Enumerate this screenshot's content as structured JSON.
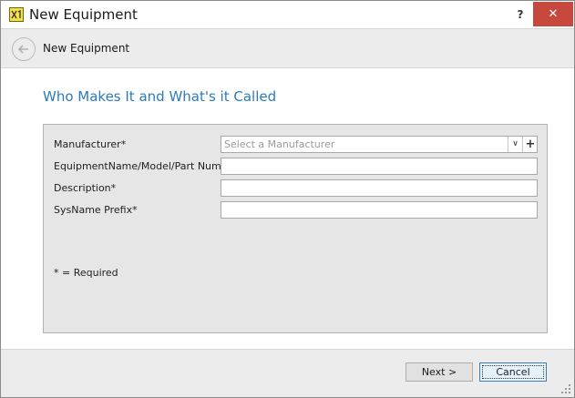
{
  "window": {
    "title": "New Equipment",
    "help_label": "?",
    "close_label": "✕"
  },
  "header": {
    "title": "New Equipment"
  },
  "main": {
    "heading": "Who Makes It and What's it Called"
  },
  "form": {
    "manufacturer_label": "Manufacturer*",
    "manufacturer_placeholder": "Select a Manufacturer",
    "dropdown_glyph": "∨",
    "add_glyph": "+",
    "equipment_name_label": "EquipmentName/Model/Part Number*",
    "equipment_name_value": "",
    "description_label": "Description*",
    "description_value": "",
    "sysname_prefix_label": "SysName Prefix*",
    "sysname_prefix_value": "",
    "required_note": "* = Required"
  },
  "footer": {
    "next_label": "Next >",
    "cancel_label": "Cancel"
  },
  "colors": {
    "accent": "#2a7bbd",
    "close_button": "#c7493e",
    "panel_bg": "#e6e6e6"
  },
  "icons": {
    "app": "app-logo-icon",
    "back": "back-arrow-icon",
    "dropdown": "chevron-down-icon",
    "add": "plus-icon"
  }
}
